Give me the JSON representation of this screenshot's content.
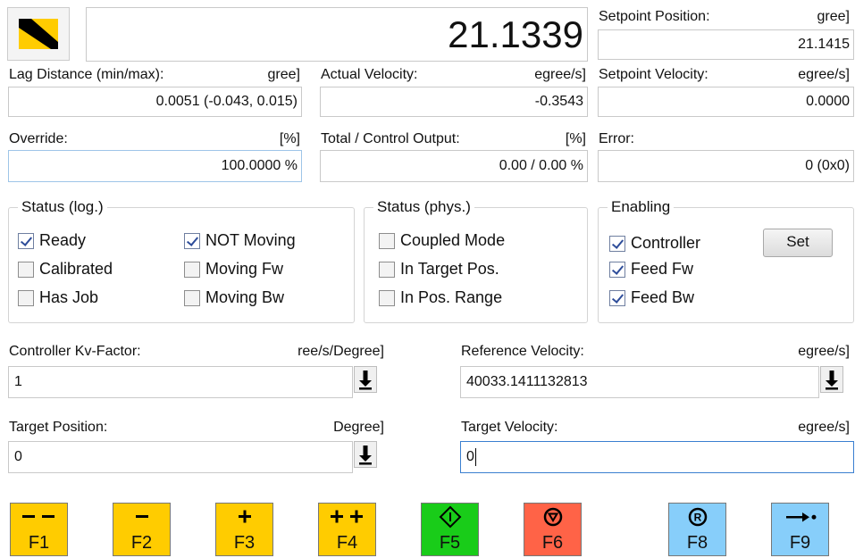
{
  "position": {
    "value": "21.1339"
  },
  "setpoint_position": {
    "label": "Setpoint Position:",
    "unit": "gree]",
    "value": "21.1415"
  },
  "lag_distance": {
    "label": "Lag Distance (min/max):",
    "unit": "gree]",
    "value": "0.0051  (-0.043, 0.015)"
  },
  "actual_velocity": {
    "label": "Actual Velocity:",
    "unit": "egree/s]",
    "value": "-0.3543"
  },
  "setpoint_velocity": {
    "label": "Setpoint Velocity:",
    "unit": "egree/s]",
    "value": "0.0000"
  },
  "override": {
    "label": "Override:",
    "unit": "[%]",
    "value": "100.0000 %"
  },
  "total_output": {
    "label": "Total / Control Output:",
    "unit": "[%]",
    "value": "0.00 /  0.00 %"
  },
  "error": {
    "label": "Error:",
    "value": "0 (0x0)"
  },
  "status_log": {
    "title": "Status (log.)",
    "items": [
      {
        "label": "Ready",
        "checked": true
      },
      {
        "label": "Calibrated",
        "checked": false
      },
      {
        "label": "Has Job",
        "checked": false
      },
      {
        "label": "NOT Moving",
        "checked": true
      },
      {
        "label": "Moving Fw",
        "checked": false
      },
      {
        "label": "Moving Bw",
        "checked": false
      }
    ]
  },
  "status_phys": {
    "title": "Status (phys.)",
    "items": [
      {
        "label": "Coupled Mode",
        "checked": false
      },
      {
        "label": "In Target Pos.",
        "checked": false
      },
      {
        "label": "In Pos. Range",
        "checked": false
      }
    ]
  },
  "enabling": {
    "title": "Enabling",
    "items": [
      {
        "label": "Controller",
        "checked": true
      },
      {
        "label": "Feed Fw",
        "checked": true
      },
      {
        "label": "Feed Bw",
        "checked": true
      }
    ],
    "set_label": "Set"
  },
  "kv_factor": {
    "label": "Controller Kv-Factor:",
    "unit": "ree/s/Degree]",
    "value": "1"
  },
  "reference_velocity": {
    "label": "Reference Velocity:",
    "unit": "egree/s]",
    "value": "40033.1411132813"
  },
  "target_position": {
    "label": "Target Position:",
    "unit": "Degree]",
    "value": "0"
  },
  "target_velocity": {
    "label": "Target Velocity:",
    "unit": "egree/s]",
    "value": "0"
  },
  "function_keys": [
    {
      "label": "F1",
      "icon": "double-minus-icon",
      "color": "#ffcc00"
    },
    {
      "label": "F2",
      "icon": "minus-icon",
      "color": "#ffcc00"
    },
    {
      "label": "F3",
      "icon": "plus-icon",
      "color": "#ffcc00"
    },
    {
      "label": "F4",
      "icon": "double-plus-icon",
      "color": "#ffcc00"
    },
    {
      "label": "F5",
      "icon": "start-icon",
      "color": "#19cc19"
    },
    {
      "label": "F6",
      "icon": "stop-icon",
      "color": "#ff6347"
    },
    {
      "label": "F8",
      "icon": "reset-icon",
      "color": "#87cefa"
    },
    {
      "label": "F9",
      "icon": "goto-icon",
      "color": "#87cefa"
    }
  ],
  "colors": {
    "accent_yellow": "#ffcc00",
    "focus_border": "#3a7fd0"
  }
}
